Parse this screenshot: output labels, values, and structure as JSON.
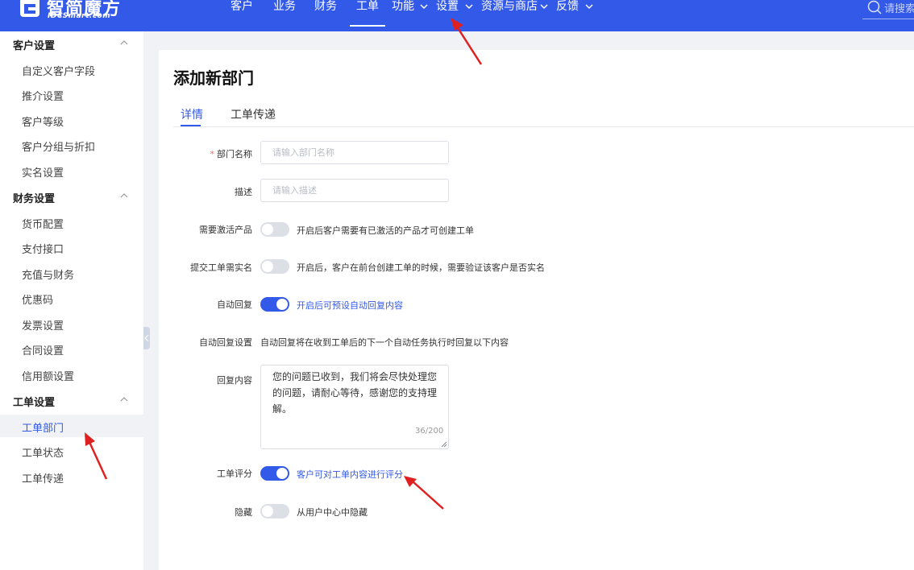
{
  "brand": {
    "name": "智简魔方",
    "tagline": "IDCSmart.com"
  },
  "topnav": {
    "items": [
      {
        "label": "客户",
        "has_dropdown": false
      },
      {
        "label": "业务",
        "has_dropdown": false
      },
      {
        "label": "财务",
        "has_dropdown": false
      },
      {
        "label": "工单",
        "has_dropdown": false,
        "active": true
      },
      {
        "label": "功能",
        "has_dropdown": true
      },
      {
        "label": "设置",
        "has_dropdown": true
      },
      {
        "label": "资源与商店",
        "has_dropdown": true
      },
      {
        "label": "反馈",
        "has_dropdown": true
      }
    ],
    "search_placeholder": "请搜索"
  },
  "sidebar": {
    "groups": [
      {
        "title": "客户设置",
        "items": [
          "自定义客户字段",
          "推介设置",
          "客户等级",
          "客户分组与折扣",
          "实名设置"
        ]
      },
      {
        "title": "财务设置",
        "items": [
          "货币配置",
          "支付接口",
          "充值与财务",
          "优惠码",
          "发票设置",
          "合同设置",
          "信用额设置"
        ]
      },
      {
        "title": "工单设置",
        "items": [
          "工单部门",
          "工单状态",
          "工单传递"
        ],
        "active_item": "工单部门"
      }
    ]
  },
  "page": {
    "title": "添加新部门",
    "tabs": [
      {
        "label": "详情",
        "active": true
      },
      {
        "label": "工单传递",
        "active": false
      }
    ]
  },
  "form": {
    "dept_name": {
      "label": "部门名称",
      "required": true,
      "placeholder": "请输入部门名称",
      "value": ""
    },
    "description": {
      "label": "描述",
      "placeholder": "请输入描述",
      "value": ""
    },
    "require_active_product": {
      "label": "需要激活产品",
      "on": false,
      "hint": "开启后客户需要有已激活的产品才可创建工单"
    },
    "require_realname": {
      "label": "提交工单需实名",
      "on": false,
      "hint": "开启后，客户在前台创建工单的时候，需要验证该客户是否实名"
    },
    "auto_reply": {
      "label": "自动回复",
      "on": true,
      "hint": "开启后可预设自动回复内容"
    },
    "auto_reply_setting": {
      "label": "自动回复设置",
      "text": "自动回复将在收到工单后的下一个自动任务执行时回复以下内容"
    },
    "reply_content": {
      "label": "回复内容",
      "value": "您的问题已收到，我们将会尽快处理您的问题，请耐心等待，感谢您的支持理解。",
      "counter": "36/200"
    },
    "ticket_rating": {
      "label": "工单评分",
      "on": true,
      "hint": "客户可对工单内容进行评分"
    },
    "hidden": {
      "label": "隐藏",
      "on": false,
      "hint": "从用户中心中隐藏"
    }
  },
  "colors": {
    "brand_blue": "#3359e8",
    "annotation_red": "#e02020",
    "page_bg": "#f0f2f5"
  }
}
